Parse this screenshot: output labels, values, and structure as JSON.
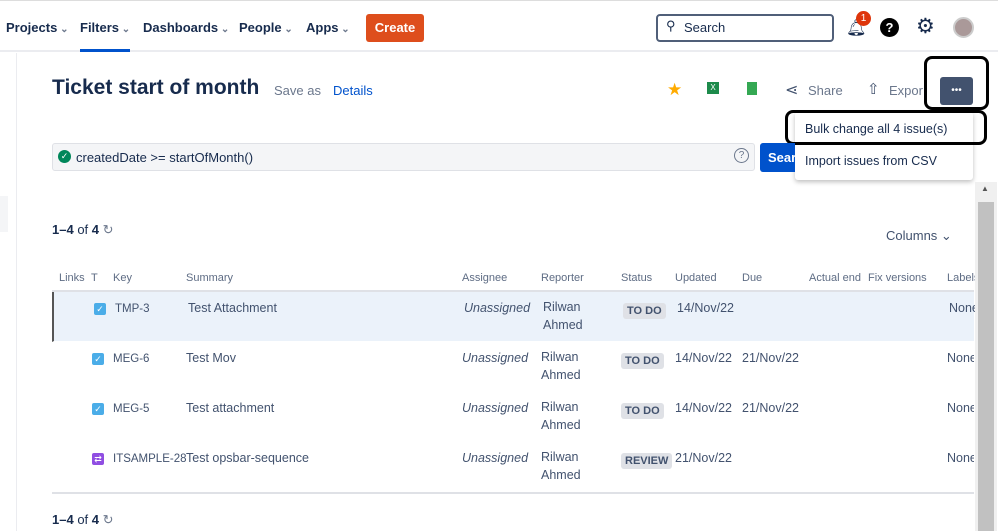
{
  "nav": {
    "items": [
      "Projects",
      "Filters",
      "Dashboards",
      "People",
      "Apps"
    ],
    "create": "Create",
    "search_placeholder": "Search",
    "notif_count": "1"
  },
  "page": {
    "title": "Ticket start of month",
    "save_as": "Save as",
    "details": "Details",
    "share": "Share",
    "export": "Export",
    "more": "•••"
  },
  "menu": {
    "items": [
      "Bulk change all 4 issue(s)",
      "Import issues from CSV"
    ]
  },
  "query": {
    "value": "createdDate >= startOfMonth()",
    "search_btn": "Search"
  },
  "results": {
    "count_top": "1–4",
    "of": "of",
    "total": "4",
    "columns_btn": "Columns ⌄"
  },
  "table": {
    "headers": [
      "Links",
      "T",
      "Key",
      "Summary",
      "Assignee",
      "Reporter",
      "Status",
      "Updated",
      "Due",
      "Actual end",
      "Fix versions",
      "Labels"
    ],
    "rows": [
      {
        "type": "task",
        "key": "TMP-3",
        "summary": "Test Attachment",
        "assignee": "Unassigned",
        "reporter": "Rilwan Ahmed",
        "status": "TO DO",
        "updated": "14/Nov/22",
        "due": "",
        "labels": "None"
      },
      {
        "type": "task",
        "key": "MEG-6",
        "summary": "Test Mov",
        "assignee": "Unassigned",
        "reporter": "Rilwan Ahmed",
        "status": "TO DO",
        "updated": "14/Nov/22",
        "due": "21/Nov/22",
        "labels": "None"
      },
      {
        "type": "task",
        "key": "MEG-5",
        "summary": "Test attachment",
        "assignee": "Unassigned",
        "reporter": "Rilwan Ahmed",
        "status": "TO DO",
        "updated": "14/Nov/22",
        "due": "21/Nov/22",
        "labels": "None"
      },
      {
        "type": "change",
        "key": "ITSAMPLE-28",
        "summary": "Test opsbar-sequence",
        "assignee": "Unassigned",
        "reporter": "Rilwan Ahmed",
        "status": "REVIEW",
        "updated": "21/Nov/22",
        "due": "",
        "labels": "None"
      }
    ]
  }
}
